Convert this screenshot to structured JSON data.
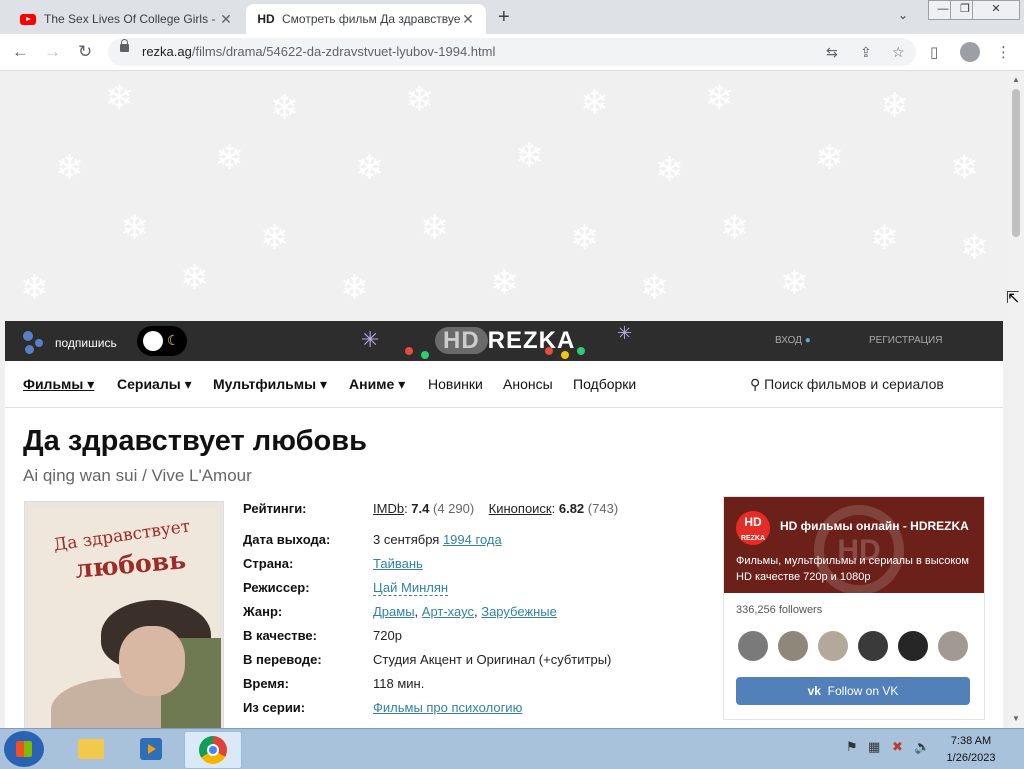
{
  "browser": {
    "tabs": [
      {
        "favicon": "youtube-icon",
        "title": "The Sex Lives Of College Girls - C"
      },
      {
        "favicon": "HD",
        "title": "Смотреть фильм Да здравствуе"
      }
    ],
    "url_host": "rezka.ag",
    "url_path": "/films/drama/54622-da-zdravstvuet-lyubov-1994.html"
  },
  "site": {
    "subscribe_label": "подпишись",
    "logo_hd": "HD",
    "logo_text": "REZKA",
    "login": "ВХОД",
    "register": "РЕГИСТРАЦИЯ",
    "menu": [
      {
        "label": "Фильмы",
        "caret": "▾"
      },
      {
        "label": "Сериалы",
        "caret": "▾"
      },
      {
        "label": "Мультфильмы",
        "caret": "▾"
      },
      {
        "label": "Аниме",
        "caret": "▾"
      },
      {
        "label": "Новинки"
      },
      {
        "label": "Анонсы"
      },
      {
        "label": "Подборки"
      }
    ],
    "search_label": "Поиск фильмов и сериалов"
  },
  "movie": {
    "title": "Да здравствует любовь",
    "original_title": "Ai qing wan sui / Vive L'Amour",
    "poster_text_1": "Да здравствует",
    "poster_text_2": "любовь",
    "ratings": {
      "label": "Рейтинги:",
      "imdb_name": "IMDb",
      "imdb_value": "7.4",
      "imdb_votes": "(4 290)",
      "kp_name": "Кинопоиск",
      "kp_value": "6.82",
      "kp_votes": "(743)"
    },
    "release": {
      "label": "Дата выхода:",
      "date": "3 сентября",
      "year": "1994 года"
    },
    "country": {
      "label": "Страна:",
      "value": "Тайвань"
    },
    "director": {
      "label": "Режиссер:",
      "value": "Цай Минлян"
    },
    "genre": {
      "label": "Жанр:",
      "values": [
        "Драмы",
        "Арт-хаус",
        "Зарубежные"
      ]
    },
    "quality": {
      "label": "В качестве:",
      "value": "720p"
    },
    "translation": {
      "label": "В переводе:",
      "value": "Студия Акцент и Оригинал (+субтитры)"
    },
    "duration": {
      "label": "Время:",
      "value": "118 мин."
    },
    "series": {
      "label": "Из серии:",
      "value": "Фильмы про психологию"
    }
  },
  "vk_widget": {
    "logo_top": "HD",
    "logo_bottom": "REZKA",
    "cover_watermark": "HD",
    "name": "HD фильмы онлайн - HDREZKA",
    "description": "Фильмы, мультфильмы и сериалы в высоком HD качестве 720p и 1080p",
    "followers": "336,256 followers",
    "follow_button": "Follow on VK"
  },
  "taskbar": {
    "time": "7:38 AM",
    "date": "1/26/2023"
  },
  "colors": {
    "accent_link": "#3281a5",
    "site_topbar": "#2d2d2d",
    "vk_button": "#5181b8"
  }
}
